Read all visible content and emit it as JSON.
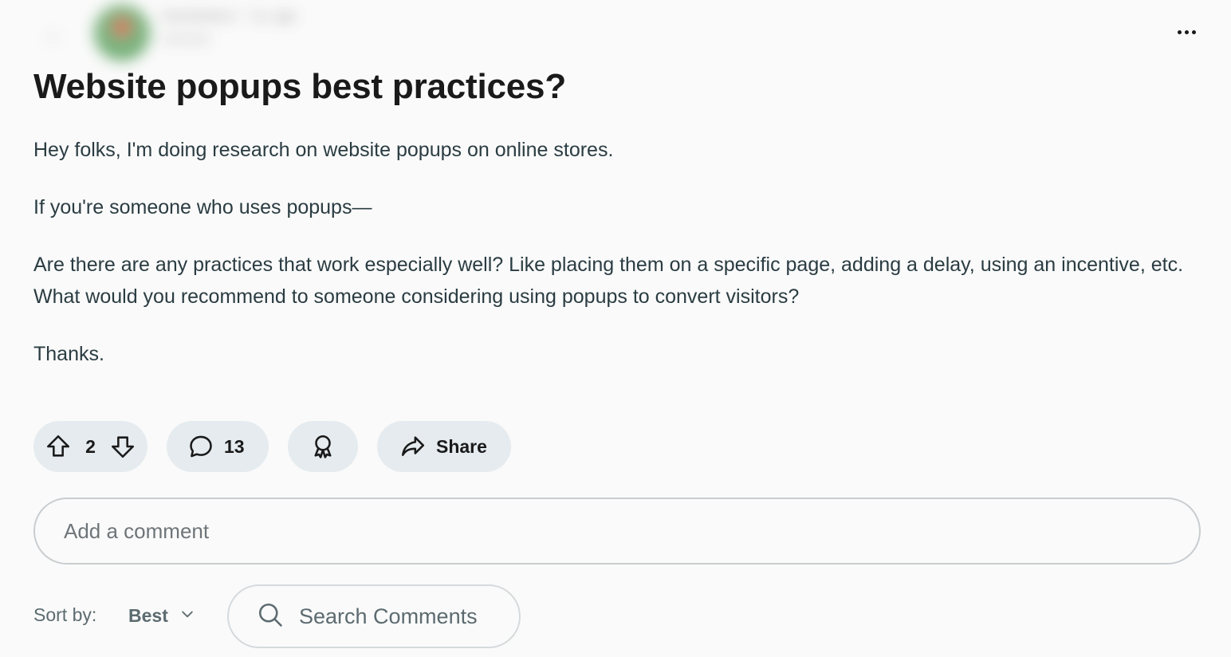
{
  "header": {
    "community_name": "r/ecommerce · 7 yr. ago",
    "author_name": "username",
    "back_icon": "back-arrow-icon",
    "overflow_icon": "more-horizontal-icon"
  },
  "post": {
    "title": "Website popups best practices?",
    "body": [
      "Hey folks, I'm doing research on website popups on online stores.",
      "If you're someone who uses popups—",
      "Are there are any practices that work especially well? Like placing them on a specific page, adding a delay, using an incentive, etc. What would you recommend to someone considering using popups to convert visitors?",
      "Thanks."
    ]
  },
  "actions": {
    "vote_count": "2",
    "comment_count": "13",
    "share_label": "Share",
    "icons": [
      "upvote-arrow-icon",
      "downvote-arrow-icon",
      "comment-bubble-icon",
      "award-ribbon-icon",
      "share-arrow-icon"
    ]
  },
  "comment_box": {
    "placeholder": "Add a comment"
  },
  "sort": {
    "label": "Sort by:",
    "value": "Best"
  },
  "search": {
    "placeholder": "Search Comments",
    "icon": "search-icon"
  },
  "colors": {
    "background": "#fafafa",
    "pill": "#e5ebee",
    "text": "#1a1a1b",
    "body_text": "#2a3c42",
    "muted_text": "#5c6b70",
    "border": "#c9cdd0"
  }
}
